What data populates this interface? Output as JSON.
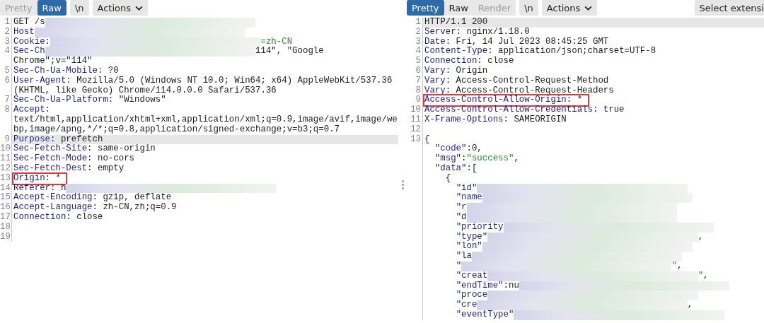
{
  "panes": [
    {
      "tabs": [
        {
          "label": "Pretty",
          "selected": false,
          "disabled": true
        },
        {
          "label": "Raw",
          "selected": true,
          "disabled": false
        }
      ],
      "buttons": [
        {
          "label": "\\n",
          "kind": "plain"
        },
        {
          "label": "Actions",
          "kind": "menu"
        }
      ],
      "lines": [
        {
          "number": "1",
          "highlighted": false,
          "boxed": false,
          "segments": [
            {
              "kind": "value",
              "text": "GET /s"
            },
            {
              "kind": "redacted"
            }
          ]
        },
        {
          "number": "2",
          "highlighted": false,
          "boxed": false,
          "segments": [
            {
              "kind": "key",
              "text": "Host"
            },
            {
              "kind": "redacted"
            }
          ]
        },
        {
          "number": "3",
          "highlighted": false,
          "boxed": false,
          "segments": [
            {
              "kind": "key",
              "text": "Cookie:"
            },
            {
              "kind": "redacted"
            },
            {
              "kind": "string",
              "text": "=zh-CN"
            }
          ]
        },
        {
          "number": "4",
          "highlighted": false,
          "boxed": false,
          "segments": [
            {
              "kind": "key",
              "text": "Sec-Ch"
            },
            {
              "kind": "redacted"
            },
            {
              "kind": "value",
              "text": "114\", \"Google "
            },
            {
              "kind": "value",
              "text": "Chrome\";v=\"114\""
            }
          ]
        },
        {
          "number": "5",
          "highlighted": false,
          "boxed": false,
          "segments": [
            {
              "kind": "key",
              "text": "Sec-Ch-Ua-Mobile:"
            },
            {
              "kind": "value",
              "text": " ?0"
            }
          ]
        },
        {
          "number": "6",
          "highlighted": false,
          "boxed": false,
          "segments": [
            {
              "kind": "key",
              "text": "User-Agent:"
            },
            {
              "kind": "value",
              "text": " Mozilla/5.0 (Windows NT 10.0; Win64; x64) AppleWebKit/537.36 (KHTML, like Gecko) Chrome/114.0.0.0 Safari/537.36"
            }
          ]
        },
        {
          "number": "7",
          "highlighted": false,
          "boxed": false,
          "segments": [
            {
              "kind": "key",
              "text": "Sec-Ch-Ua-Platform:"
            },
            {
              "kind": "value",
              "text": " \"Windows\""
            }
          ]
        },
        {
          "number": "8",
          "highlighted": false,
          "boxed": false,
          "segments": [
            {
              "kind": "key",
              "text": "Accept:"
            },
            {
              "kind": "value",
              "text": " text/html,application/xhtml+xml,application/xml;q=0.9,image/avif,image/webp,image/apng,*/*;q=0.8,application/signed-exchange;v=b3;q=0.7"
            }
          ]
        },
        {
          "number": "9",
          "highlighted": true,
          "boxed": false,
          "segments": [
            {
              "kind": "key",
              "text": "Purpose:"
            },
            {
              "kind": "value",
              "text": " prefetch"
            }
          ]
        },
        {
          "number": "10",
          "highlighted": false,
          "boxed": false,
          "segments": [
            {
              "kind": "key",
              "text": "Sec-Fetch-Site:"
            },
            {
              "kind": "value",
              "text": " same-origin"
            }
          ]
        },
        {
          "number": "11",
          "highlighted": false,
          "boxed": false,
          "segments": [
            {
              "kind": "key",
              "text": "Sec-Fetch-Mode:"
            },
            {
              "kind": "value",
              "text": " no-cors"
            }
          ]
        },
        {
          "number": "12",
          "highlighted": false,
          "boxed": false,
          "segments": [
            {
              "kind": "key",
              "text": "Sec-Fetch-Dest:"
            },
            {
              "kind": "value",
              "text": " empty"
            }
          ]
        },
        {
          "number": "13",
          "highlighted": false,
          "boxed": true,
          "segments": [
            {
              "kind": "key",
              "text": "Origin:"
            },
            {
              "kind": "value",
              "text": " *"
            }
          ]
        },
        {
          "number": "14",
          "highlighted": false,
          "boxed": false,
          "segments": [
            {
              "kind": "key",
              "text": "Referer:"
            },
            {
              "kind": "value",
              "text": " h"
            },
            {
              "kind": "redacted"
            }
          ]
        },
        {
          "number": "15",
          "highlighted": false,
          "boxed": false,
          "segments": [
            {
              "kind": "key",
              "text": "Accept-Encoding:"
            },
            {
              "kind": "value",
              "text": " gzip, deflate"
            }
          ]
        },
        {
          "number": "16",
          "highlighted": false,
          "boxed": false,
          "segments": [
            {
              "kind": "key",
              "text": "Accept-Language:"
            },
            {
              "kind": "value",
              "text": " zh-CN,zh;q=0.9"
            }
          ]
        },
        {
          "number": "17",
          "highlighted": false,
          "boxed": false,
          "segments": [
            {
              "kind": "key",
              "text": "Connection:"
            },
            {
              "kind": "value",
              "text": " close"
            }
          ]
        },
        {
          "number": "18",
          "highlighted": false,
          "boxed": false
        },
        {
          "number": "19",
          "highlighted": false,
          "boxed": false
        }
      ]
    },
    {
      "tabs": [
        {
          "label": "Pretty",
          "selected": true,
          "disabled": false
        },
        {
          "label": "Raw",
          "selected": false,
          "disabled": false
        },
        {
          "label": "Render",
          "selected": false,
          "disabled": true
        }
      ],
      "buttons": [
        {
          "label": "\\n",
          "kind": "plain"
        },
        {
          "label": "Actions",
          "kind": "menu"
        },
        {
          "label": "Select extensi",
          "kind": "extension"
        }
      ],
      "lines": [
        {
          "number": "1",
          "highlighted": true,
          "boxed": false,
          "segments": [
            {
              "kind": "value",
              "text": "HTTP/1.1 200"
            }
          ]
        },
        {
          "number": "2",
          "highlighted": false,
          "boxed": false,
          "segments": [
            {
              "kind": "key",
              "text": "Server:"
            },
            {
              "kind": "value",
              "text": " nginx/1.18.0"
            }
          ]
        },
        {
          "number": "3",
          "highlighted": false,
          "boxed": false,
          "segments": [
            {
              "kind": "key",
              "text": "Date:"
            },
            {
              "kind": "value",
              "text": " Fri, 14 Jul 2023 08:45:25 GMT"
            }
          ]
        },
        {
          "number": "4",
          "highlighted": false,
          "boxed": false,
          "segments": [
            {
              "kind": "key",
              "text": "Content-Type:"
            },
            {
              "kind": "value",
              "text": " application/json;charset=UTF-8"
            }
          ]
        },
        {
          "number": "5",
          "highlighted": false,
          "boxed": false,
          "segments": [
            {
              "kind": "key",
              "text": "Connection:"
            },
            {
              "kind": "value",
              "text": " close"
            }
          ]
        },
        {
          "number": "6",
          "highlighted": false,
          "boxed": false,
          "segments": [
            {
              "kind": "key",
              "text": "Vary:"
            },
            {
              "kind": "value",
              "text": " Origin"
            }
          ]
        },
        {
          "number": "7",
          "highlighted": false,
          "boxed": false,
          "segments": [
            {
              "kind": "key",
              "text": "Vary:"
            },
            {
              "kind": "value",
              "text": " Access-Control-Request-Method"
            }
          ]
        },
        {
          "number": "8",
          "highlighted": false,
          "boxed": false,
          "segments": [
            {
              "kind": "key",
              "text": "Vary:"
            },
            {
              "kind": "value",
              "text": " Access-Control-Request-Headers"
            }
          ]
        },
        {
          "number": "9",
          "highlighted": false,
          "boxed": true,
          "segments": [
            {
              "kind": "key",
              "text": "Access-Control-Allow-Origin:"
            },
            {
              "kind": "value",
              "text": " *"
            }
          ]
        },
        {
          "number": "10",
          "highlighted": false,
          "boxed": false,
          "segments": [
            {
              "kind": "key",
              "text": "Access-Control-Allow-Credentials:"
            },
            {
              "kind": "value",
              "text": " true"
            }
          ]
        },
        {
          "number": "11",
          "highlighted": false,
          "boxed": false,
          "segments": [
            {
              "kind": "key",
              "text": "X-Frame-Options:"
            },
            {
              "kind": "value",
              "text": " SAMEORIGIN"
            }
          ]
        },
        {
          "number": "12",
          "highlighted": false,
          "boxed": false
        },
        {
          "number": "13",
          "highlighted": false,
          "boxed": false,
          "segments": [
            {
              "kind": "value",
              "text": "{"
            }
          ]
        },
        {
          "highlighted": false,
          "boxed": false,
          "segments": [
            {
              "kind": "key",
              "text": "  \"code\""
            },
            {
              "kind": "value",
              "text": ":0,"
            }
          ]
        },
        {
          "highlighted": false,
          "boxed": false,
          "segments": [
            {
              "kind": "key",
              "text": "  \"msg\""
            },
            {
              "kind": "value",
              "text": ":"
            },
            {
              "kind": "string",
              "text": "\"success\""
            },
            {
              "kind": "value",
              "text": ","
            }
          ]
        },
        {
          "highlighted": false,
          "boxed": false,
          "segments": [
            {
              "kind": "key",
              "text": "  \"data\""
            },
            {
              "kind": "value",
              "text": ":["
            }
          ]
        },
        {
          "highlighted": false,
          "boxed": false,
          "segments": [
            {
              "kind": "value",
              "text": "    {"
            }
          ]
        },
        {
          "highlighted": false,
          "boxed": false,
          "segments": [
            {
              "kind": "key",
              "text": "      \"id\""
            },
            {
              "kind": "redacted"
            }
          ]
        },
        {
          "highlighted": false,
          "boxed": false,
          "segments": [
            {
              "kind": "key",
              "text": "      \"name"
            },
            {
              "kind": "redacted"
            }
          ]
        },
        {
          "highlighted": false,
          "boxed": false,
          "segments": [
            {
              "kind": "key",
              "text": "      \"r"
            },
            {
              "kind": "redacted"
            }
          ]
        },
        {
          "highlighted": false,
          "boxed": false,
          "segments": [
            {
              "kind": "key",
              "text": "      \"d"
            },
            {
              "kind": "redacted"
            }
          ]
        },
        {
          "highlighted": false,
          "boxed": false,
          "segments": [
            {
              "kind": "key",
              "text": "      \"priority"
            },
            {
              "kind": "redacted"
            }
          ]
        },
        {
          "highlighted": false,
          "boxed": false,
          "segments": [
            {
              "kind": "key",
              "text": "      \"type\""
            },
            {
              "kind": "redacted"
            },
            {
              "kind": "value",
              "text": ","
            }
          ]
        },
        {
          "highlighted": false,
          "boxed": false,
          "segments": [
            {
              "kind": "key",
              "text": "      \"lon\""
            },
            {
              "kind": "redacted"
            }
          ]
        },
        {
          "highlighted": false,
          "boxed": false,
          "segments": [
            {
              "kind": "key",
              "text": "      \"la"
            },
            {
              "kind": "redacted"
            }
          ]
        },
        {
          "highlighted": false,
          "boxed": false,
          "segments": [
            {
              "kind": "key",
              "text": "      \""
            },
            {
              "kind": "redacted"
            },
            {
              "kind": "string",
              "text": "\""
            },
            {
              "kind": "value",
              "text": ","
            }
          ]
        },
        {
          "highlighted": false,
          "boxed": false,
          "segments": [
            {
              "kind": "key",
              "text": "      \"creat"
            },
            {
              "kind": "redacted"
            },
            {
              "kind": "string",
              "text": "\""
            },
            {
              "kind": "value",
              "text": ","
            }
          ]
        },
        {
          "highlighted": false,
          "boxed": false,
          "segments": [
            {
              "kind": "key",
              "text": "      \"endTime\""
            },
            {
              "kind": "value",
              "text": ":nu"
            },
            {
              "kind": "redacted"
            }
          ]
        },
        {
          "highlighted": false,
          "boxed": false,
          "segments": [
            {
              "kind": "key",
              "text": "      \"proce"
            },
            {
              "kind": "redacted"
            }
          ]
        },
        {
          "highlighted": false,
          "boxed": false,
          "segments": [
            {
              "kind": "key",
              "text": "      \"cre"
            },
            {
              "kind": "redacted"
            },
            {
              "kind": "value",
              "text": ","
            }
          ]
        },
        {
          "highlighted": false,
          "boxed": false,
          "segments": [
            {
              "kind": "key",
              "text": "      \"eventType\""
            },
            {
              "kind": "redacted"
            }
          ]
        }
      ]
    }
  ]
}
